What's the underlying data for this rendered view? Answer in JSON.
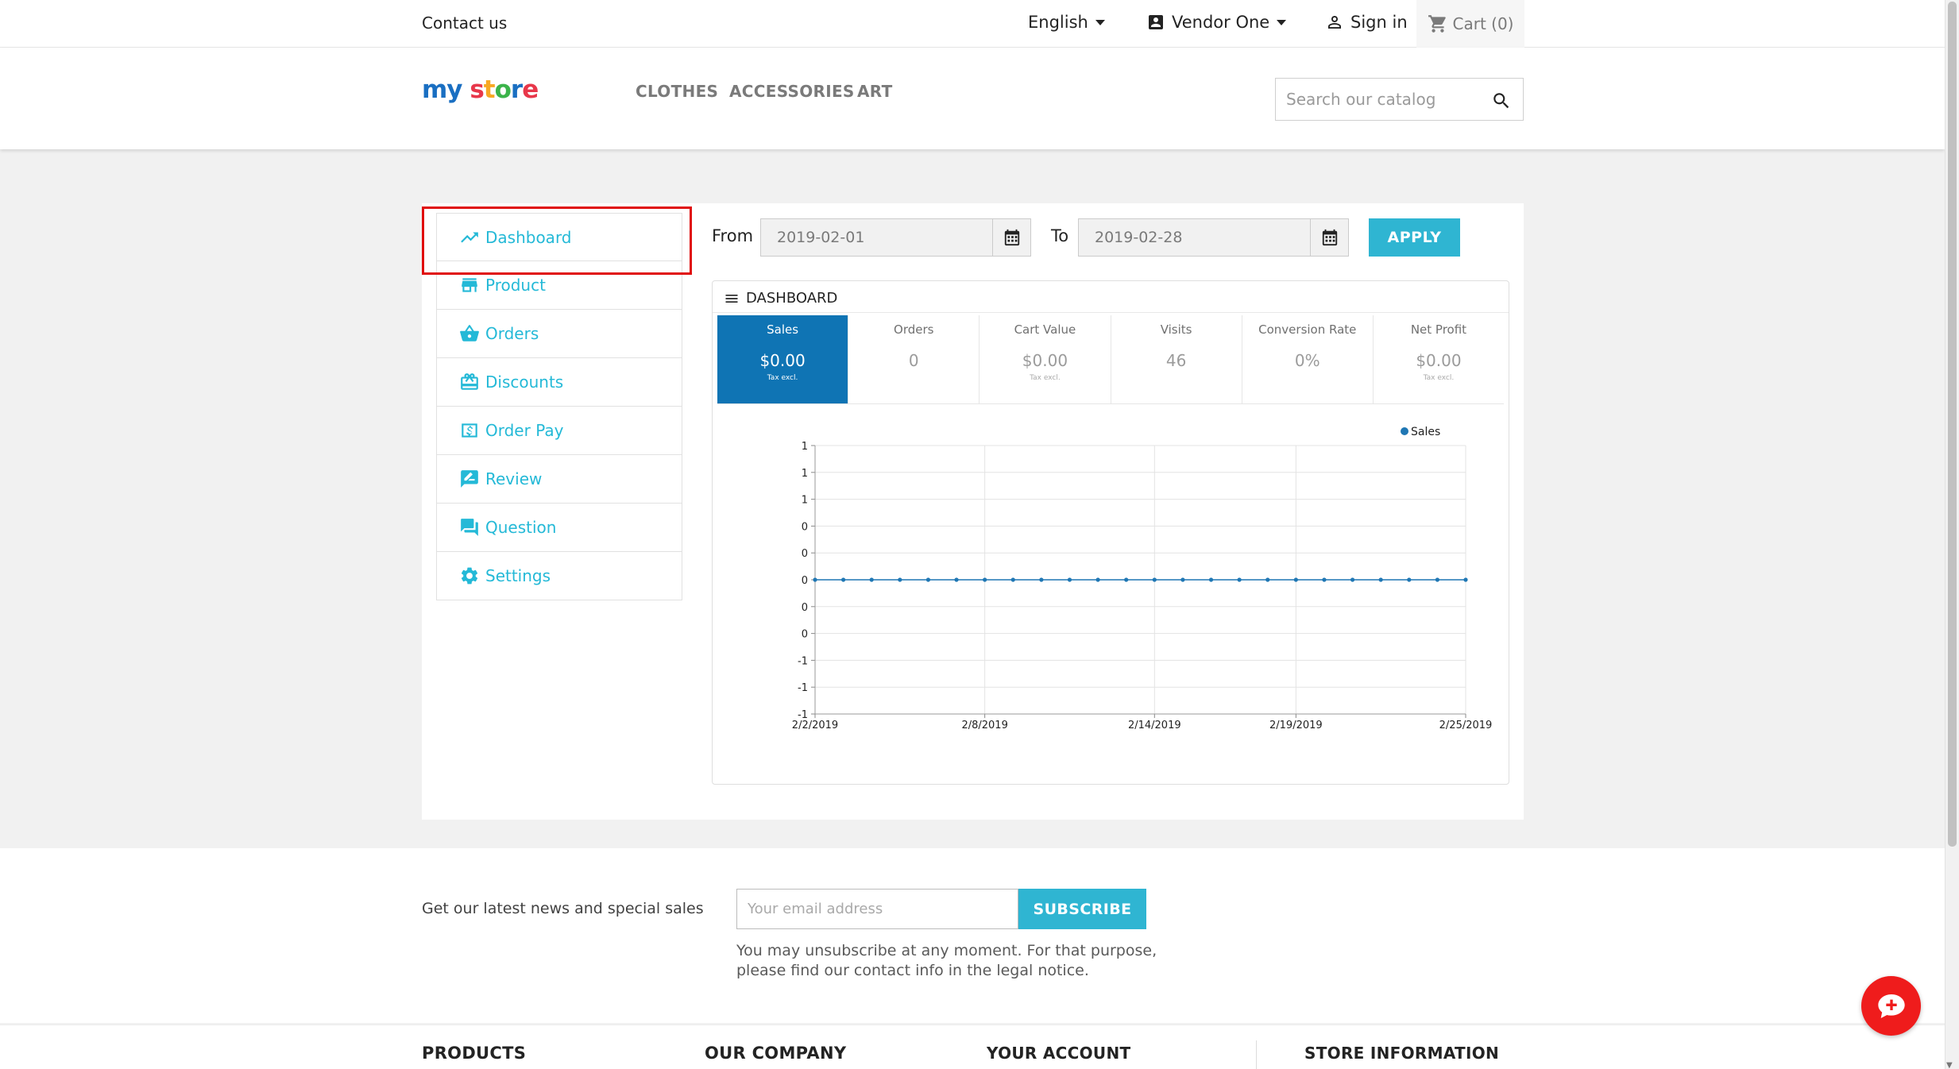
{
  "topbar": {
    "contact": "Contact us",
    "language": "English",
    "vendor": "Vendor One",
    "sign_in": "Sign in",
    "cart": "Cart (0)"
  },
  "header": {
    "logo_my": "my",
    "logo_store": "store",
    "nav": [
      "CLOTHES",
      "ACCESSORIES",
      "ART"
    ],
    "search_placeholder": "Search our catalog"
  },
  "sidebar": {
    "items": [
      {
        "label": "Dashboard",
        "icon": "trending-up-icon"
      },
      {
        "label": "Product",
        "icon": "storefront-icon"
      },
      {
        "label": "Orders",
        "icon": "basket-icon"
      },
      {
        "label": "Discounts",
        "icon": "gift-card-icon"
      },
      {
        "label": "Order Pay",
        "icon": "dollar-box-icon"
      },
      {
        "label": "Review",
        "icon": "rate-review-icon"
      },
      {
        "label": "Question",
        "icon": "forum-icon"
      },
      {
        "label": "Settings",
        "icon": "gear-icon"
      }
    ]
  },
  "filter": {
    "from_label": "From",
    "from_value": "2019-02-01",
    "to_label": "To",
    "to_value": "2019-02-28",
    "apply_label": "APPLY"
  },
  "dashboard": {
    "title": "DASHBOARD",
    "kpis": [
      {
        "label": "Sales",
        "value": "$0.00",
        "sub": "Tax excl."
      },
      {
        "label": "Orders",
        "value": "0",
        "sub": ""
      },
      {
        "label": "Cart Value",
        "value": "$0.00",
        "sub": "Tax excl."
      },
      {
        "label": "Visits",
        "value": "46",
        "sub": ""
      },
      {
        "label": "Conversion Rate",
        "value": "0%",
        "sub": ""
      },
      {
        "label": "Net Profit",
        "value": "$0.00",
        "sub": "Tax excl."
      }
    ]
  },
  "chart_data": {
    "type": "line",
    "series": [
      {
        "name": "Sales",
        "color": "#1f77b4",
        "values": [
          0,
          0,
          0,
          0,
          0,
          0,
          0,
          0,
          0,
          0,
          0,
          0,
          0,
          0,
          0,
          0,
          0,
          0,
          0,
          0,
          0,
          0,
          0,
          0
        ]
      }
    ],
    "x": [
      "2/2/2019",
      "2/3/2019",
      "2/4/2019",
      "2/5/2019",
      "2/6/2019",
      "2/7/2019",
      "2/8/2019",
      "2/9/2019",
      "2/10/2019",
      "2/11/2019",
      "2/12/2019",
      "2/13/2019",
      "2/14/2019",
      "2/15/2019",
      "2/16/2019",
      "2/17/2019",
      "2/18/2019",
      "2/19/2019",
      "2/20/2019",
      "2/21/2019",
      "2/22/2019",
      "2/23/2019",
      "2/24/2019",
      "2/25/2019"
    ],
    "x_tick_labels": [
      "2/2/2019",
      "2/8/2019",
      "2/14/2019",
      "2/19/2019",
      "2/25/2019"
    ],
    "y_tick_labels": [
      "1",
      "1",
      "1",
      "0",
      "0",
      "0",
      "0",
      "0",
      "-1",
      "-1",
      "-1"
    ],
    "legend": "top-right",
    "grid": true
  },
  "newsletter": {
    "text": "Get our latest news and special sales",
    "email_placeholder": "Your email address",
    "subscribe_label": "SUBSCRIBE",
    "note_line1": "You may unsubscribe at any moment. For that purpose,",
    "note_line2": "please find our contact info in the legal notice."
  },
  "footer": {
    "products": "PRODUCTS",
    "company": "OUR COMPANY",
    "account": "YOUR ACCOUNT",
    "store_info": "STORE INFORMATION"
  },
  "colors": {
    "accent": "#2fb5d2",
    "active_kpi": "#0f74b4",
    "highlight": "#e00d0d",
    "float_button": "#ef1c1c"
  }
}
